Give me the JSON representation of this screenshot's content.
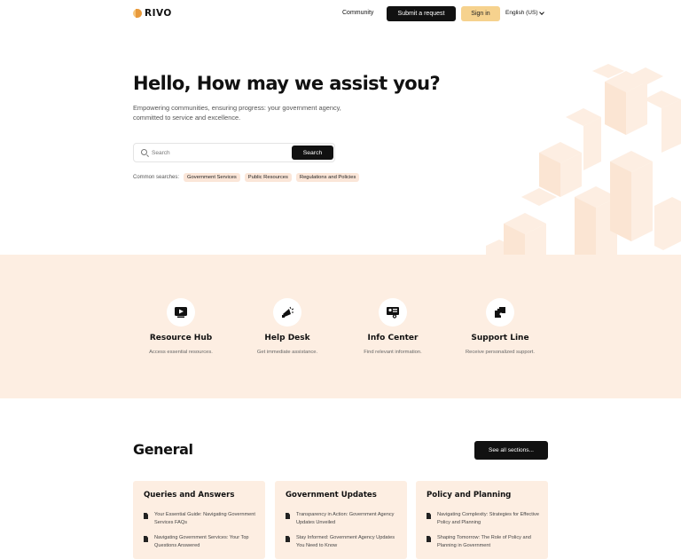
{
  "header": {
    "logo_text": "RIVO",
    "nav_community": "Community",
    "submit_label": "Submit a request",
    "signin_label": "Sign in",
    "language": "English (US)"
  },
  "hero": {
    "title": "Hello, How may we assist you?",
    "subtitle": "Empowering communities, ensuring progress: your government agency, committed to service and excellence.",
    "search_placeholder": "Search",
    "search_button": "Search",
    "common_label": "Common searches:",
    "common_searches": [
      "Government Services",
      "Public Resources",
      "Regulations and Policies"
    ]
  },
  "features": [
    {
      "icon": "video-icon",
      "title": "Resource Hub",
      "desc": "Access essential resources."
    },
    {
      "icon": "megaphone-icon",
      "title": "Help Desk",
      "desc": "Get immediate assistance."
    },
    {
      "icon": "id-card-icon",
      "title": "Info Center",
      "desc": "Find relevant information."
    },
    {
      "icon": "puzzle-icon",
      "title": "Support Line",
      "desc": "Receive personalized support."
    }
  ],
  "general": {
    "title": "General",
    "see_all": "See all sections...",
    "cards": [
      {
        "title": "Queries and Answers",
        "articles": [
          "Your Essential Guide: Navigating Government Services FAQs",
          "Navigating Government Services: Your Top Questions Answered"
        ]
      },
      {
        "title": "Government Updates",
        "articles": [
          "Transparency in Action: Government Agency Updates Unveiled",
          "Stay Informed: Government Agency Updates You Need to Know"
        ]
      },
      {
        "title": "Policy and Planning",
        "articles": [
          "Navigating Complexity: Strategies for Effective Policy and Planning",
          "Shaping Tomorrow: The Role of Policy and Planning in Government"
        ]
      }
    ]
  },
  "colors": {
    "accent_light": "#fdeee2",
    "chip_bg": "#fbe6d8",
    "signin_bg": "#f6d28e",
    "dark": "#111111"
  }
}
